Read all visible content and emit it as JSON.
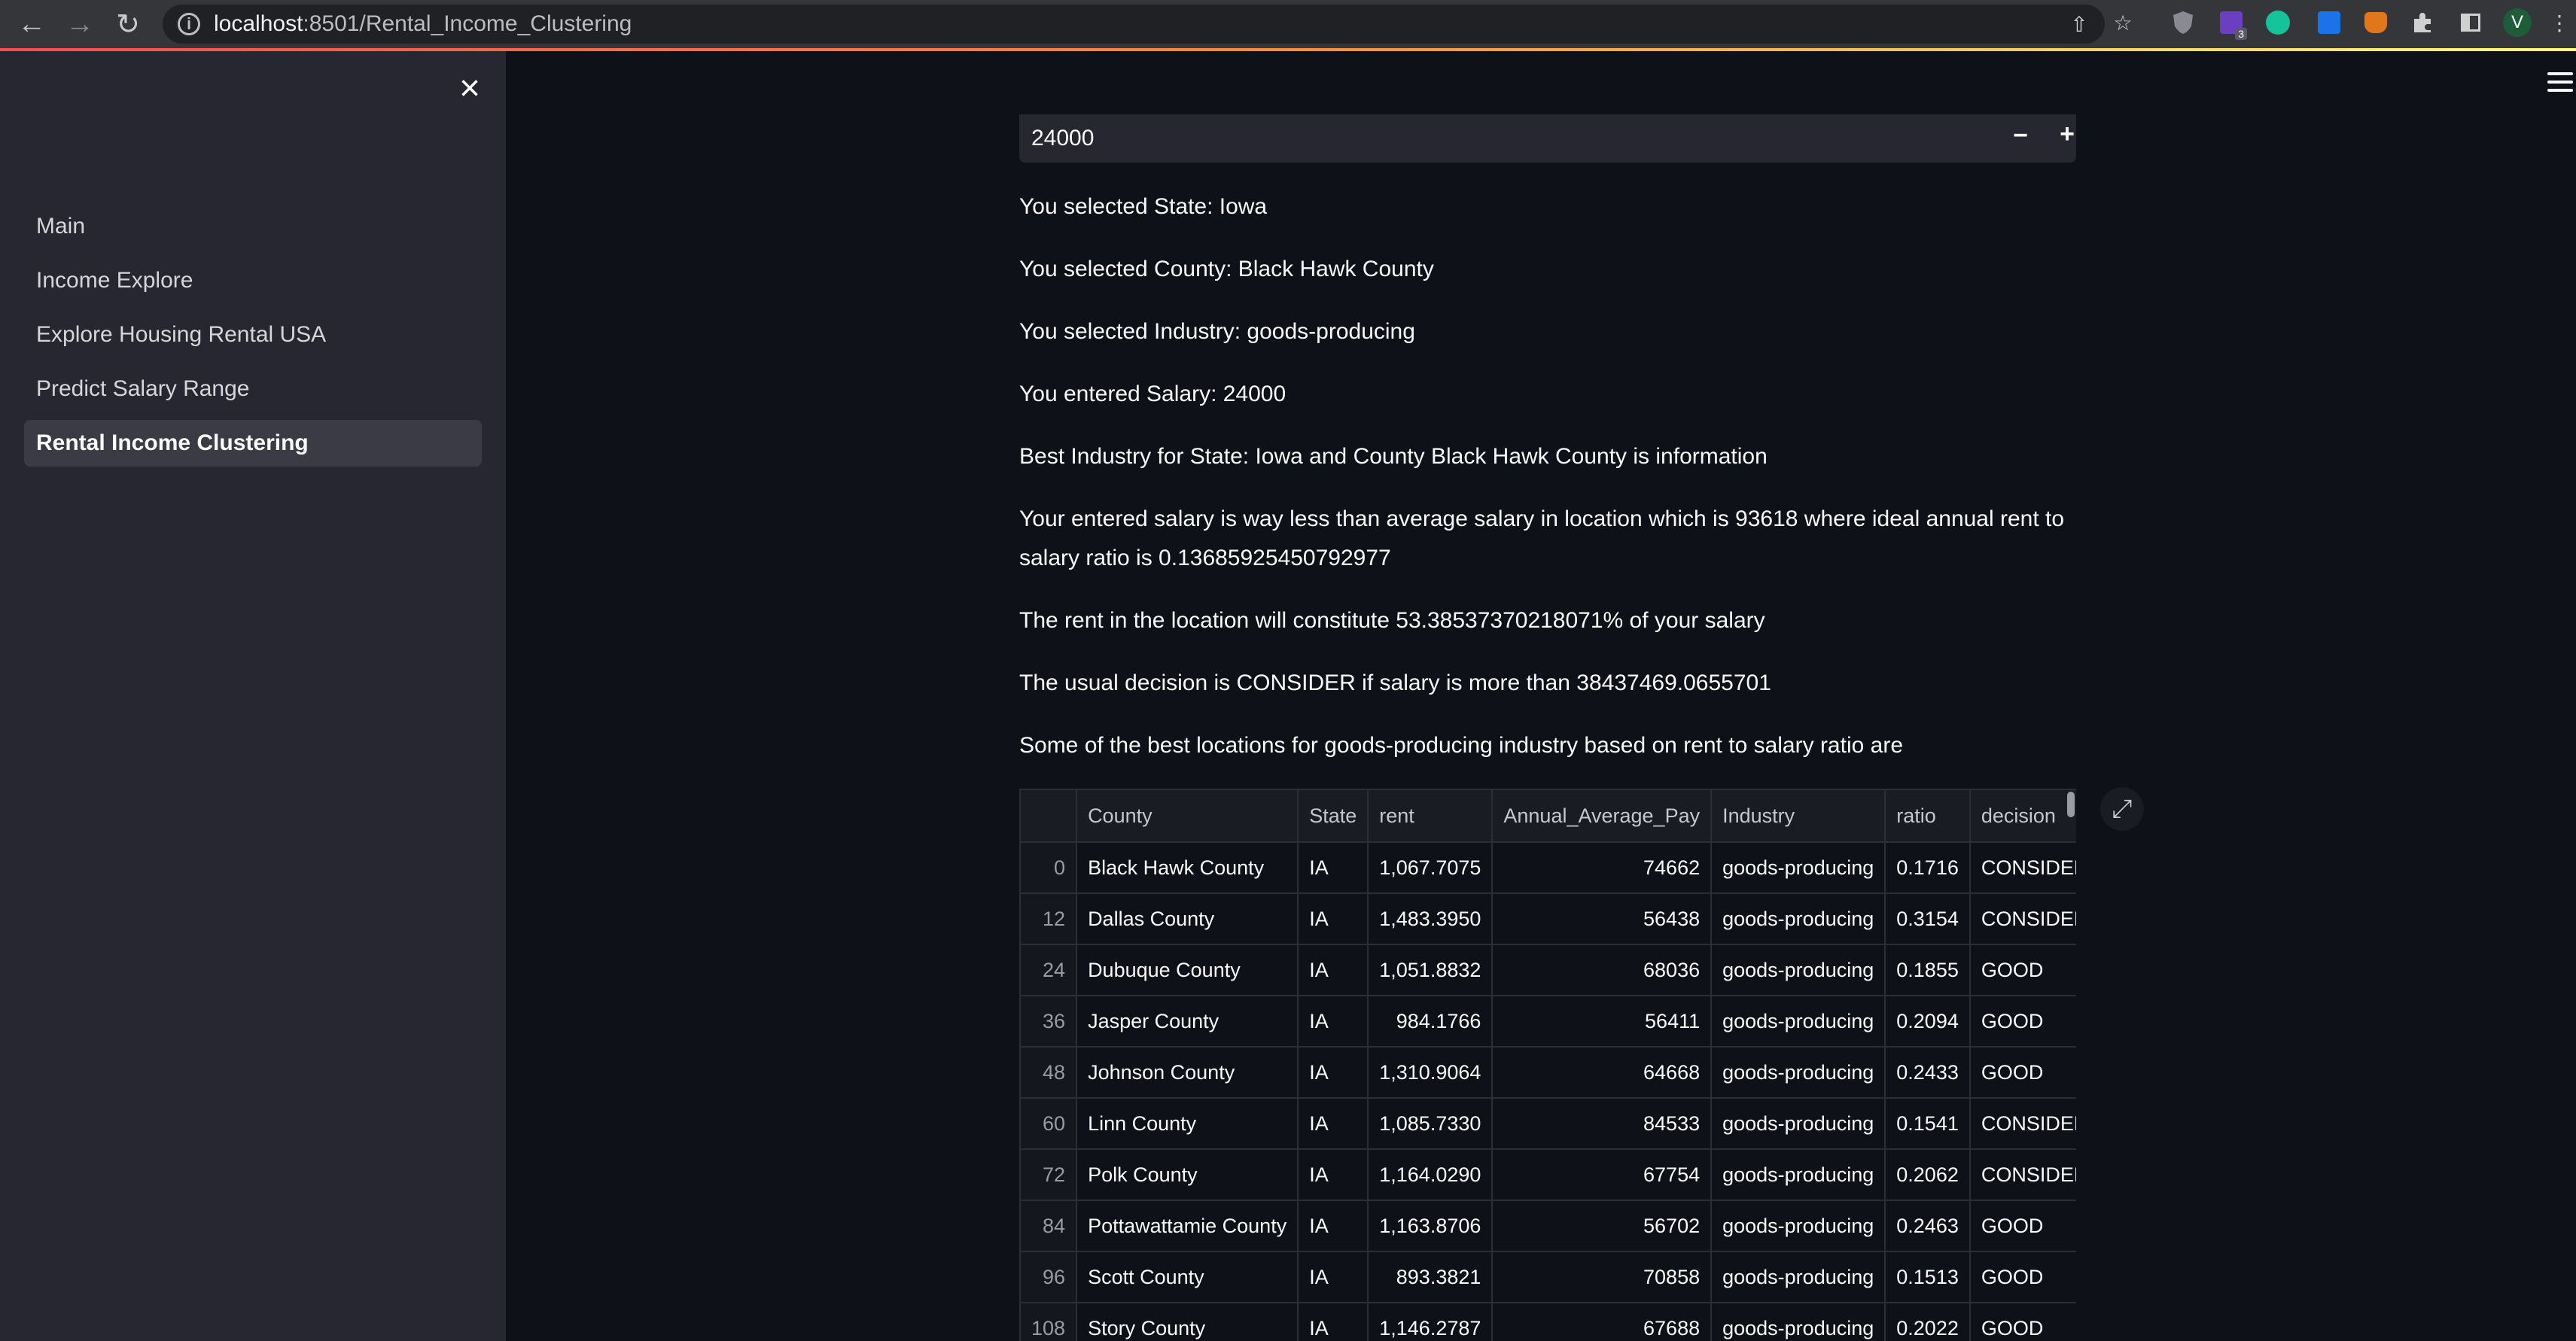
{
  "browser": {
    "url_host": "localhost",
    "url_path": ":8501/Rental_Income_Clustering",
    "profile_initial": "V",
    "extension_badge_count": "3"
  },
  "sidebar": {
    "items": [
      {
        "label": "Main",
        "active": false
      },
      {
        "label": "Income Explore",
        "active": false
      },
      {
        "label": "Explore Housing Rental USA",
        "active": false
      },
      {
        "label": "Predict Salary Range",
        "active": false
      },
      {
        "label": "Rental Income Clustering",
        "active": true
      }
    ]
  },
  "main": {
    "salary_input_value": "24000",
    "messages": [
      "You selected State: Iowa",
      "You selected County: Black Hawk County",
      "You selected Industry: goods-producing",
      "You entered Salary: 24000",
      "Best Industry for State: Iowa and County Black Hawk County is information",
      "Your entered salary is way less than average salary in location which is 93618 where ideal annual rent to salary ratio is 0.13685925450792977",
      "The rent in the location will constitute 53.38537370218071% of your salary",
      "The usual decision is CONSIDER if salary is more than 38437469.0655701",
      "Some of the best locations for goods-producing industry based on rent to salary ratio are"
    ],
    "table": {
      "columns": [
        "",
        "County",
        "State",
        "rent",
        "Annual_Average_Pay",
        "Industry",
        "ratio",
        "decision"
      ],
      "rows": [
        [
          "0",
          "Black Hawk County",
          "IA",
          "1,067.7075",
          "74662",
          "goods-producing",
          "0.1716",
          "CONSIDER"
        ],
        [
          "12",
          "Dallas County",
          "IA",
          "1,483.3950",
          "56438",
          "goods-producing",
          "0.3154",
          "CONSIDER"
        ],
        [
          "24",
          "Dubuque County",
          "IA",
          "1,051.8832",
          "68036",
          "goods-producing",
          "0.1855",
          "GOOD"
        ],
        [
          "36",
          "Jasper County",
          "IA",
          "984.1766",
          "56411",
          "goods-producing",
          "0.2094",
          "GOOD"
        ],
        [
          "48",
          "Johnson County",
          "IA",
          "1,310.9064",
          "64668",
          "goods-producing",
          "0.2433",
          "GOOD"
        ],
        [
          "60",
          "Linn County",
          "IA",
          "1,085.7330",
          "84533",
          "goods-producing",
          "0.1541",
          "CONSIDER"
        ],
        [
          "72",
          "Polk County",
          "IA",
          "1,164.0290",
          "67754",
          "goods-producing",
          "0.2062",
          "CONSIDER"
        ],
        [
          "84",
          "Pottawattamie County",
          "IA",
          "1,163.8706",
          "56702",
          "goods-producing",
          "0.2463",
          "GOOD"
        ],
        [
          "96",
          "Scott County",
          "IA",
          "893.3821",
          "70858",
          "goods-producing",
          "0.1513",
          "GOOD"
        ],
        [
          "108",
          "Story County",
          "IA",
          "1,146.2787",
          "67688",
          "goods-producing",
          "0.2022",
          "GOOD"
        ]
      ]
    }
  }
}
